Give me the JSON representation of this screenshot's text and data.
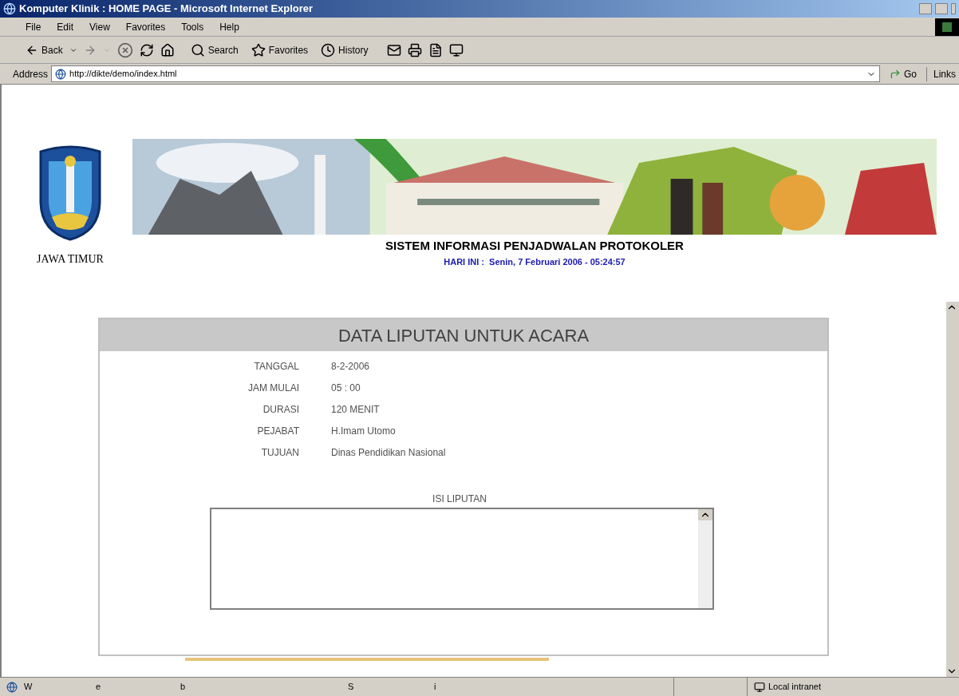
{
  "window": {
    "title": "Komputer Klinik : HOME PAGE - Microsoft Internet Explorer"
  },
  "menu": [
    "File",
    "Edit",
    "View",
    "Favorites",
    "Tools",
    "Help"
  ],
  "toolbar": {
    "back": "Back",
    "search": "Search",
    "favorites": "Favorites",
    "history": "History"
  },
  "address_bar": {
    "label": "Address",
    "value": "http://dikte/demo/index.html",
    "go": "Go",
    "links": "Links"
  },
  "page": {
    "logo_caption": "JAWA TIMUR",
    "heading": "SISTEM INFORMASI PENJADWALAN PROTOKOLER",
    "date_line": "HARI INI :  Senin, 7 Februari 2006 - 05:24:57"
  },
  "panel": {
    "title": "DATA LIPUTAN UNTUK ACARA",
    "fields": [
      {
        "label": "TANGGAL",
        "value": "8-2-2006"
      },
      {
        "label": "JAM MULAI",
        "value": "05 : 00"
      },
      {
        "label": "DURASI",
        "value": "120 MENIT"
      },
      {
        "label": "PEJABAT",
        "value": "H.Imam Utomo"
      },
      {
        "label": "TUJUAN",
        "value": "Dinas Pendidikan Nasional"
      }
    ],
    "content_label": "ISI LIPUTAN"
  },
  "status_bar": {
    "texts": [
      "W",
      "e",
      "b",
      "S",
      "i"
    ],
    "zone": "Local intranet"
  }
}
